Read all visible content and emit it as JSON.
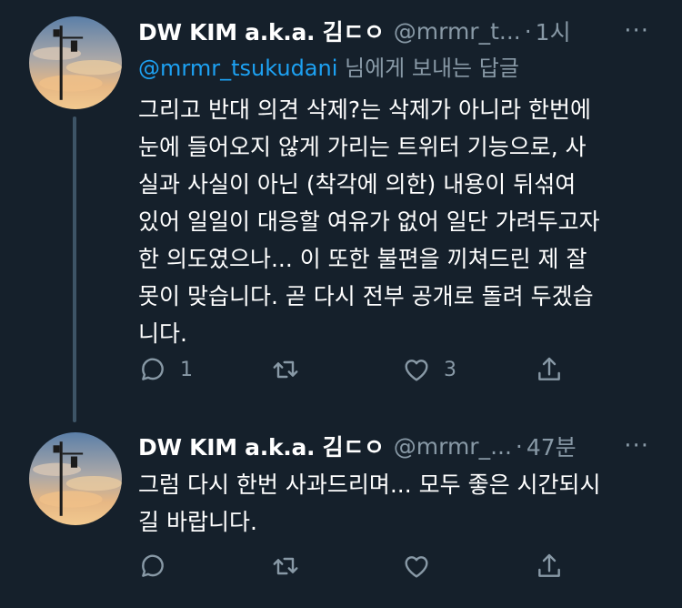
{
  "tweets": [
    {
      "name": "DW KIM a.k.a. 김ㄷㅇ",
      "handle": "@mrmr_t...",
      "separator": "·",
      "time": "1시",
      "more": "···",
      "reply_to": {
        "mention": "@mrmr_tsukudani",
        "suffix": " 님에게 보내는 답글"
      },
      "lines": [
        "그리고 반대 의견 삭제?는 삭제가 아니라 한번에",
        "눈에 들어오지 않게 가리는 트위터 기능으로, 사",
        "실과 사실이 아닌 (착각에 의한) 내용이 뒤섞여",
        "있어 일일이 대응할 여유가 없어 일단 가려두고자",
        "한 의도였으나... 이 또한 불편을 끼쳐드린 제 잘",
        "못이 맞습니다. 곧 다시 전부 공개로 돌려 두겠습",
        "니다."
      ],
      "reply_count": "1",
      "retweet_count": "",
      "like_count": "3"
    },
    {
      "name": "DW KIM a.k.a. 김ㄷㅇ",
      "handle": "@mrmr_...",
      "separator": "·",
      "time": "47분",
      "more": "···",
      "lines": [
        "그럼 다시 한번 사과드리며... 모두 좋은 시간되시",
        "길 바랍니다."
      ],
      "reply_count": "",
      "retweet_count": "",
      "like_count": ""
    }
  ],
  "colors": {
    "background": "#15202b",
    "secondary_text": "#8899a6",
    "mention": "#1da1f2",
    "thread_line": "#3d5466"
  },
  "icons": [
    "reply-icon",
    "retweet-icon",
    "like-icon",
    "share-icon",
    "more-icon"
  ]
}
